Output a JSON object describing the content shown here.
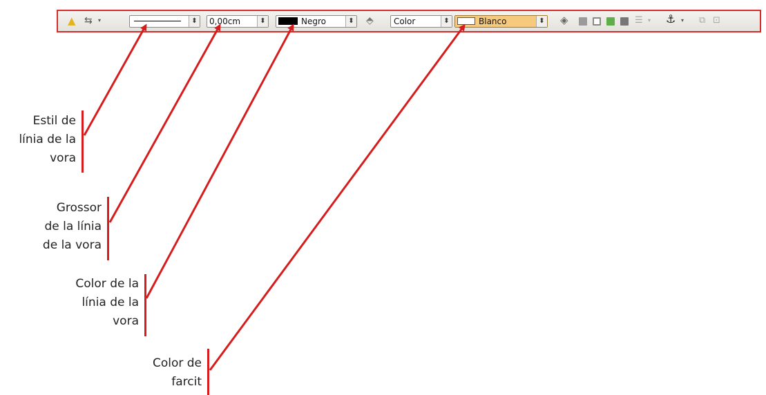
{
  "toolbar": {
    "line_style_value": "",
    "line_width_value": "0,00cm",
    "line_color_value": "Negro",
    "area_style_value": "Color",
    "fill_color_value": "Blanco",
    "colors": {
      "line_color": "#000000",
      "fill_color": "#ffffff",
      "fill_highlight": "#f7c97d",
      "border": "#d92b2b"
    },
    "icons": [
      "highlight-icon",
      "line-ends-icon",
      "dropdown-arrow-icon",
      "area-icon",
      "shadow-icon",
      "wrap-off-icon",
      "wrap-page-icon",
      "wrap-through-icon",
      "bring-to-front-icon",
      "align-icon",
      "anchor-icon",
      "group-icon",
      "frame-icon"
    ]
  },
  "annotations": [
    {
      "lines": [
        "Estil de",
        "línia de la",
        "vora"
      ]
    },
    {
      "lines": [
        "Grossor",
        "de la línia",
        "de la vora"
      ]
    },
    {
      "lines": [
        "Color de la",
        "línia de la",
        "vora"
      ]
    },
    {
      "lines": [
        "Color de",
        "farcit"
      ]
    }
  ],
  "accent": "#d61c1c"
}
